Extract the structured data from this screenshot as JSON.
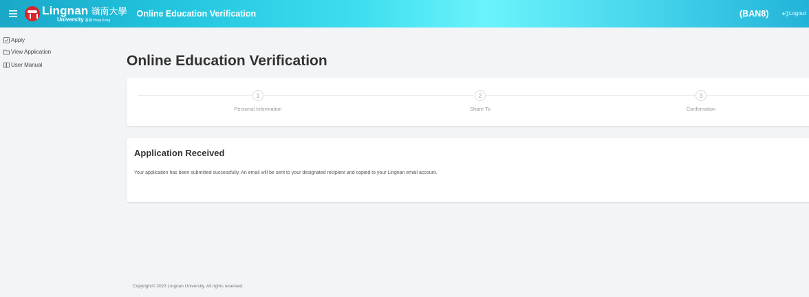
{
  "header": {
    "brand_name": "Lingnan",
    "brand_chinese": "嶺南大學",
    "brand_sub": "University",
    "brand_sub_small": "香港 Hong Kong",
    "app_title": "Online Education Verification",
    "user_code": "(BAN8)",
    "logout_label": "Logout",
    "colors": {
      "gradient_start": "#1aa7c8",
      "gradient_mid": "#6af3fb",
      "logo_red": "#d9262b"
    }
  },
  "sidebar": {
    "items": [
      {
        "label": "Apply",
        "icon": "checkbox-icon"
      },
      {
        "label": "View Application",
        "icon": "folder-icon"
      },
      {
        "label": "User Manual",
        "icon": "book-icon"
      }
    ]
  },
  "main": {
    "title": "Online Education Verification",
    "steps": [
      {
        "number": "1",
        "label": "Personal Information"
      },
      {
        "number": "2",
        "label": "Share To"
      },
      {
        "number": "3",
        "label": "Confirmation"
      }
    ],
    "result": {
      "heading": "Application Received",
      "message": "Your application has been submitted successfully. An email will be sent to your designated recipient and copied to your Lingnan email account."
    }
  },
  "footer": {
    "copyright": "Copyright© 2023 Lingnan University. All rights reserved."
  }
}
